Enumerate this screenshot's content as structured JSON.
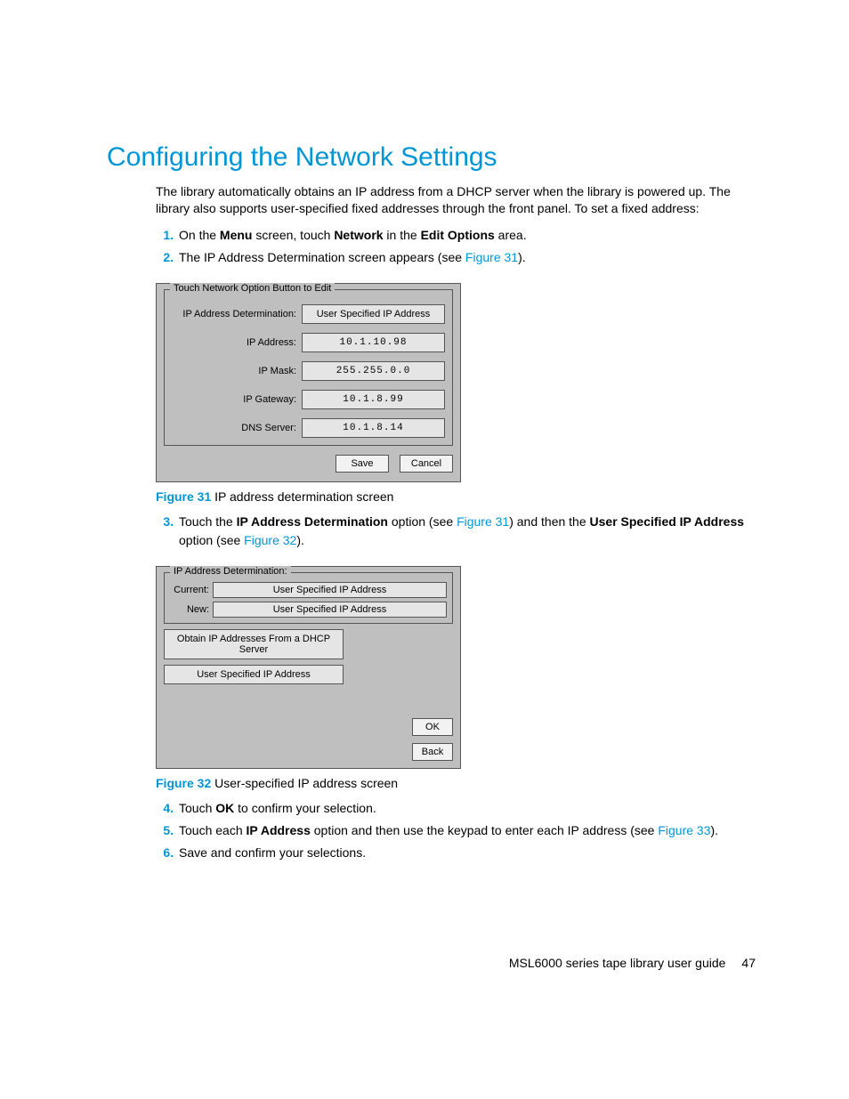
{
  "heading": "Configuring the Network Settings",
  "intro": "The library automatically obtains an IP address from a DHCP server when the library is powered up. The library also supports user-specified fixed addresses through the front panel. To set a fixed address:",
  "steps": {
    "s1": {
      "a": "On the ",
      "b": "Menu",
      "c": " screen, touch ",
      "d": "Network",
      "e": " in the ",
      "f": "Edit Options",
      "g": " area."
    },
    "s2": {
      "a": "The IP Address Determination screen appears (see ",
      "link": "Figure 31",
      "b": ")."
    },
    "s3": {
      "a": "Touch the ",
      "b": "IP Address Determination",
      "c": " option (see ",
      "link1": "Figure 31",
      "d": ") and then the ",
      "e": "User Specified IP Address",
      "f": " option (see ",
      "link2": "Figure 32",
      "g": ")."
    },
    "s4": {
      "a": "Touch ",
      "b": "OK",
      "c": " to confirm your selection."
    },
    "s5": {
      "a": "Touch each ",
      "b": "IP Address",
      "c": " option and then use the keypad to enter each IP address (see ",
      "link": "Figure 33",
      "d": ")."
    },
    "s6": "Save and confirm your selections."
  },
  "fig31": {
    "legend": "Touch Network Option Button to Edit",
    "rows": {
      "det_label": "IP Address Determination:",
      "det_value": "User Specified IP Address",
      "addr_label": "IP Address:",
      "addr_value": "10.1.10.98",
      "mask_label": "IP Mask:",
      "mask_value": "255.255.0.0",
      "gw_label": "IP Gateway:",
      "gw_value": "10.1.8.99",
      "dns_label": "DNS Server:",
      "dns_value": "10.1.8.14"
    },
    "save": "Save",
    "cancel": "Cancel",
    "caption_label": "Figure 31",
    "caption_text": " IP address determination screen"
  },
  "fig32": {
    "legend": "IP Address Determination:",
    "current_label": "Current:",
    "current_value": "User Specified IP Address",
    "new_label": "New:",
    "new_value": "User Specified IP Address",
    "opt_dhcp": "Obtain IP Addresses From a DHCP Server",
    "opt_user": "User Specified IP Address",
    "ok": "OK",
    "back": "Back",
    "caption_label": "Figure 32",
    "caption_text": " User-specified IP address screen"
  },
  "footer": {
    "text": "MSL6000 series tape library user guide",
    "page": "47"
  }
}
